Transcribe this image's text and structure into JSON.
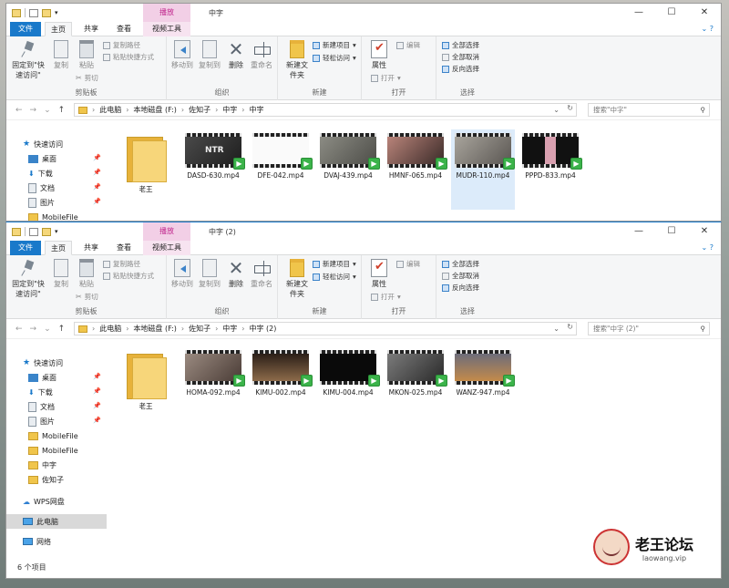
{
  "windows": [
    {
      "title": "中字",
      "context_tab": "播放",
      "ribbon": {
        "tabs": [
          "文件",
          "主页",
          "共享",
          "查看",
          "视频工具"
        ],
        "pin_label": "固定到\"快速访问\"",
        "copy": "复制",
        "paste": "粘贴",
        "copy_path": "复制路径",
        "paste_shortcut": "粘贴快捷方式",
        "cut": "剪切",
        "clipboard": "剪贴板",
        "move_to": "移动到",
        "copy_to": "复制到",
        "delete": "删除",
        "rename": "重命名",
        "organize": "组织",
        "new_item": "新建项目",
        "easy_access": "轻松访问",
        "new_folder": "新建文件夹",
        "new": "新建",
        "properties": "属性",
        "open": "打开",
        "edit": "编辑",
        "open_grp": "打开",
        "select_all": "全部选择",
        "select_none": "全部取消",
        "invert": "反向选择",
        "select": "选择"
      },
      "breadcrumb": [
        "此电脑",
        "本地磁盘 (F:)",
        "佐知子",
        "中字",
        "中字"
      ],
      "search_placeholder": "搜索\"中字\"",
      "sidebar": [
        {
          "label": "快速访问",
          "icon": "star-icon"
        },
        {
          "label": "桌面",
          "icon": "desktop-icon"
        },
        {
          "label": "下载",
          "icon": "download-icon"
        },
        {
          "label": "文档",
          "icon": "document-icon"
        },
        {
          "label": "图片",
          "icon": "picture-icon"
        },
        {
          "label": "MobileFile",
          "icon": "folder-icon"
        }
      ],
      "files": [
        {
          "name": "老王",
          "type": "folder"
        },
        {
          "name": "DASD-630.mp4",
          "type": "video"
        },
        {
          "name": "DFE-042.mp4",
          "type": "video"
        },
        {
          "name": "DVAJ-439.mp4",
          "type": "video"
        },
        {
          "name": "HMNF-065.mp4",
          "type": "video"
        },
        {
          "name": "MUDR-110.mp4",
          "type": "video",
          "selected": true
        },
        {
          "name": "PPPD-833.mp4",
          "type": "video"
        }
      ]
    },
    {
      "title": "中字 (2)",
      "context_tab": "播放",
      "ribbon": {
        "tabs": [
          "文件",
          "主页",
          "共享",
          "查看",
          "视频工具"
        ],
        "pin_label": "固定到\"快速访问\"",
        "copy": "复制",
        "paste": "粘贴",
        "copy_path": "复制路径",
        "paste_shortcut": "粘贴快捷方式",
        "cut": "剪切",
        "clipboard": "剪贴板",
        "move_to": "移动到",
        "copy_to": "复制到",
        "delete": "删除",
        "rename": "重命名",
        "organize": "组织",
        "new_item": "新建项目",
        "easy_access": "轻松访问",
        "new_folder": "新建文件夹",
        "new": "新建",
        "properties": "属性",
        "open": "打开",
        "edit": "编辑",
        "open_grp": "打开",
        "select_all": "全部选择",
        "select_none": "全部取消",
        "invert": "反向选择",
        "select": "选择"
      },
      "breadcrumb": [
        "此电脑",
        "本地磁盘 (F:)",
        "佐知子",
        "中字",
        "中字 (2)"
      ],
      "search_placeholder": "搜索\"中字 (2)\"",
      "sidebar": [
        {
          "label": "快速访问",
          "icon": "star-icon"
        },
        {
          "label": "桌面",
          "icon": "desktop-icon"
        },
        {
          "label": "下载",
          "icon": "download-icon"
        },
        {
          "label": "文档",
          "icon": "document-icon"
        },
        {
          "label": "图片",
          "icon": "picture-icon"
        },
        {
          "label": "MobileFile",
          "icon": "folder-icon"
        },
        {
          "label": "MobileFile",
          "icon": "folder-icon"
        },
        {
          "label": "中字",
          "icon": "folder-icon"
        },
        {
          "label": "佐知子",
          "icon": "folder-icon"
        },
        {
          "label": "WPS网盘",
          "icon": "cloud-icon"
        },
        {
          "label": "此电脑",
          "icon": "computer-icon"
        },
        {
          "label": "网络",
          "icon": "network-icon"
        }
      ],
      "files": [
        {
          "name": "老王",
          "type": "folder"
        },
        {
          "name": "HOMA-092.mp4",
          "type": "video"
        },
        {
          "name": "KIMU-002.mp4",
          "type": "video"
        },
        {
          "name": "KIMU-004.mp4",
          "type": "video"
        },
        {
          "name": "MKON-025.mp4",
          "type": "video"
        },
        {
          "name": "WANZ-947.mp4",
          "type": "video"
        }
      ],
      "status": "6 个项目"
    }
  ],
  "window_controls": [
    "—",
    "☐",
    "✕"
  ],
  "thumb_labels": {
    "ntr": "NTR"
  },
  "watermark": {
    "title": "老王论坛",
    "url": "laowang.vip"
  }
}
